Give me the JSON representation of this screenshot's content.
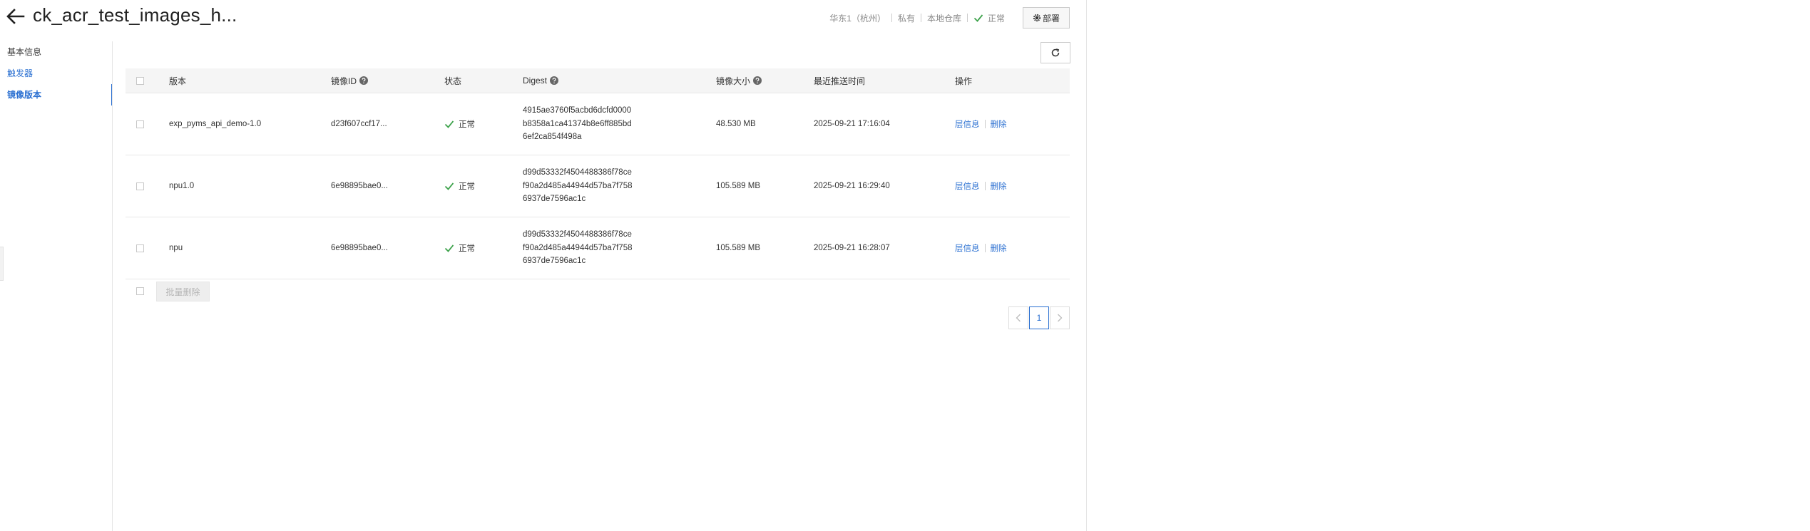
{
  "header": {
    "title": "ck_acr_test_images_h...",
    "region": "华东1（杭州）",
    "visibility": "私有",
    "repo_type": "本地仓库",
    "status": "正常",
    "deploy_label": "部署"
  },
  "sidebar": {
    "items": [
      {
        "label": "基本信息"
      },
      {
        "label": "触发器"
      },
      {
        "label": "镜像版本"
      }
    ]
  },
  "table": {
    "columns": {
      "version": "版本",
      "image_id": "镜像ID",
      "status": "状态",
      "digest": "Digest",
      "size": "镜像大小",
      "pushed": "最近推送时间",
      "ops": "操作"
    },
    "rows": [
      {
        "version": "exp_pyms_api_demo-1.0",
        "image_id": "d23f607ccf17...",
        "status": "正常",
        "digest": [
          "4915ae3760f5acbd6dcfd0000",
          "b8358a1ca41374b8e6ff885bd",
          "6ef2ca854f498a"
        ],
        "size": "48.530 MB",
        "pushed": "2025-09-21 17:16:04",
        "op_layers": "层信息",
        "op_delete": "删除"
      },
      {
        "version": "npu1.0",
        "image_id": "6e98895bae0...",
        "status": "正常",
        "digest": [
          "d99d53332f4504488386f78ce",
          "f90a2d485a44944d57ba7f758",
          "6937de7596ac1c"
        ],
        "size": "105.589 MB",
        "pushed": "2025-09-21 16:29:40",
        "op_layers": "层信息",
        "op_delete": "删除"
      },
      {
        "version": "npu",
        "image_id": "6e98895bae0...",
        "status": "正常",
        "digest": [
          "d99d53332f4504488386f78ce",
          "f90a2d485a44944d57ba7f758",
          "6937de7596ac1c"
        ],
        "size": "105.589 MB",
        "pushed": "2025-09-21 16:28:07",
        "op_layers": "层信息",
        "op_delete": "删除"
      }
    ]
  },
  "footer": {
    "batch_delete_label": "批量删除"
  },
  "pagination": {
    "current": "1"
  },
  "colors": {
    "accent": "#2a6fd1",
    "success": "#3fa34d"
  }
}
